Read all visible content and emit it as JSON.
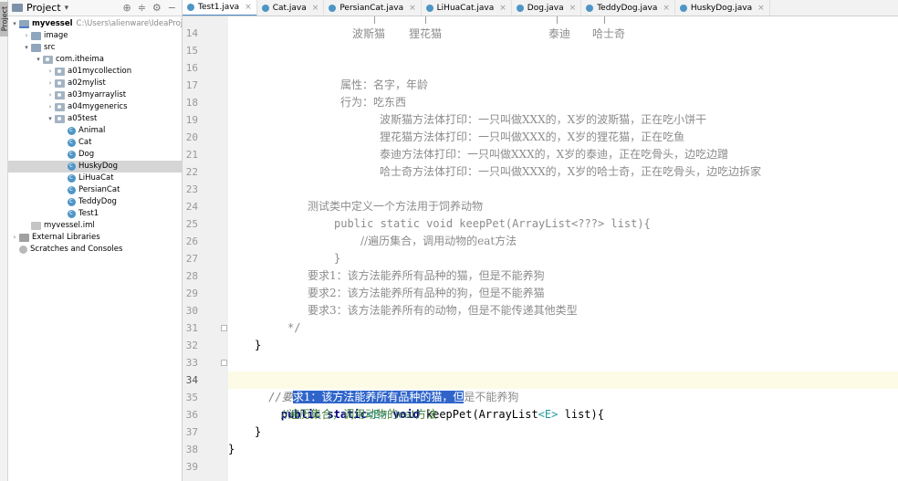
{
  "tool_strip": {
    "label": "Project"
  },
  "project": {
    "header_title": "Project",
    "header_dropdown": "▾",
    "header_icons": [
      "⊕",
      "≑",
      "⚙",
      "−"
    ],
    "tree": [
      {
        "indent": 0,
        "arrow": "▾",
        "icon": "module",
        "label": "myvessel",
        "bold": true,
        "path": "C:\\Users\\alienware\\IdeaProjects\\"
      },
      {
        "indent": 1,
        "arrow": "›",
        "icon": "folder",
        "label": "image"
      },
      {
        "indent": 1,
        "arrow": "▾",
        "icon": "folder",
        "label": "src"
      },
      {
        "indent": 2,
        "arrow": "▾",
        "icon": "package",
        "label": "com.itheima"
      },
      {
        "indent": 3,
        "arrow": "›",
        "icon": "package",
        "label": "a01mycollection"
      },
      {
        "indent": 3,
        "arrow": "›",
        "icon": "package",
        "label": "a02mylist"
      },
      {
        "indent": 3,
        "arrow": "›",
        "icon": "package",
        "label": "a03myarraylist"
      },
      {
        "indent": 3,
        "arrow": "›",
        "icon": "package",
        "label": "a04mygenerics"
      },
      {
        "indent": 3,
        "arrow": "▾",
        "icon": "package",
        "label": "a05test"
      },
      {
        "indent": 4,
        "arrow": "",
        "icon": "class",
        "label": "Animal"
      },
      {
        "indent": 4,
        "arrow": "",
        "icon": "class",
        "label": "Cat"
      },
      {
        "indent": 4,
        "arrow": "",
        "icon": "class",
        "label": "Dog"
      },
      {
        "indent": 4,
        "arrow": "",
        "icon": "class",
        "label": "HuskyDog",
        "selected": true
      },
      {
        "indent": 4,
        "arrow": "",
        "icon": "class",
        "label": "LiHuaCat"
      },
      {
        "indent": 4,
        "arrow": "",
        "icon": "class",
        "label": "PersianCat"
      },
      {
        "indent": 4,
        "arrow": "",
        "icon": "class",
        "label": "TeddyDog"
      },
      {
        "indent": 4,
        "arrow": "",
        "icon": "class",
        "label": "Test1"
      },
      {
        "indent": 1,
        "arrow": "",
        "icon": "iml",
        "label": "myvessel.iml"
      },
      {
        "indent": 0,
        "arrow": "›",
        "icon": "lib",
        "label": "External Libraries"
      },
      {
        "indent": 0,
        "arrow": "",
        "icon": "scratch",
        "label": "Scratches and Consoles"
      }
    ]
  },
  "tabs": [
    {
      "label": "Test1.java",
      "active": true,
      "close": "×"
    },
    {
      "label": "Cat.java",
      "close": "×"
    },
    {
      "label": "PersianCat.java",
      "close": "×"
    },
    {
      "label": "LiHuaCat.java",
      "close": "×"
    },
    {
      "label": "Dog.java",
      "close": "×"
    },
    {
      "label": "TeddyDog.java",
      "close": "×"
    },
    {
      "label": "HuskyDog.java",
      "close": "×"
    }
  ],
  "gutter": {
    "line_numbers": [
      "14",
      "15",
      "16",
      "17",
      "18",
      "19",
      "20",
      "21",
      "22",
      "23",
      "24",
      "25",
      "26",
      "27",
      "28",
      "29",
      "30",
      "31",
      "32",
      "33",
      "34",
      "35",
      "36",
      "37",
      "38",
      "39"
    ]
  },
  "editor": {
    "tree_labels": {
      "persian": "波斯猫",
      "lihua": "狸花猫",
      "teddy": "泰迪",
      "husky": "哈士奇"
    },
    "comment_block": {
      "attrs": "属性：名字，年龄",
      "behavior": "行为：吃东西",
      "persian_eat": "波斯猫方法体打印：一只叫做XXX的，X岁的波斯猫，正在吃小饼干",
      "lihua_eat": "狸花猫方法体打印：一只叫做XXX的，X岁的狸花猫，正在吃鱼",
      "teddy_eat": "泰迪方法体打印：一只叫做XXX的，X岁的泰迪，正在吃骨头，边吃边蹭",
      "husky_eat": "哈士奇方法体打印：一只叫做XXX的，X岁的哈士奇，正在吃骨头，边吃边拆家",
      "test_desc": "测试类中定义一个方法用于饲养动物",
      "method_sig": "public static void keepPet(ArrayList<???> list){",
      "loop_comment": "//遍历集合，调用动物的eat方法",
      "close_brace": "}",
      "req1": "要求1：该方法能养所有品种的猫，但是不能养狗",
      "req2": "要求2：该方法能养所有品种的狗，但是不能养猫",
      "req3": "要求3：该方法能养所有的动物，但是不能传递其他类型",
      "end_comment": "*/"
    },
    "line32": "}",
    "line34": {
      "before_sel": "//要",
      "selected": "求1：该方法能养所有品种的猫，但",
      "after_sel": "是不能养狗"
    },
    "line35": {
      "kw1": "public static",
      "gen1": "<E>",
      "kw2": " void ",
      "method": "keepPet(ArrayList",
      "gen2": "<E>",
      "rest": " list){"
    },
    "line36": "//遍历集合，调用动物的eat方法",
    "line37": "}",
    "line38": "}"
  }
}
